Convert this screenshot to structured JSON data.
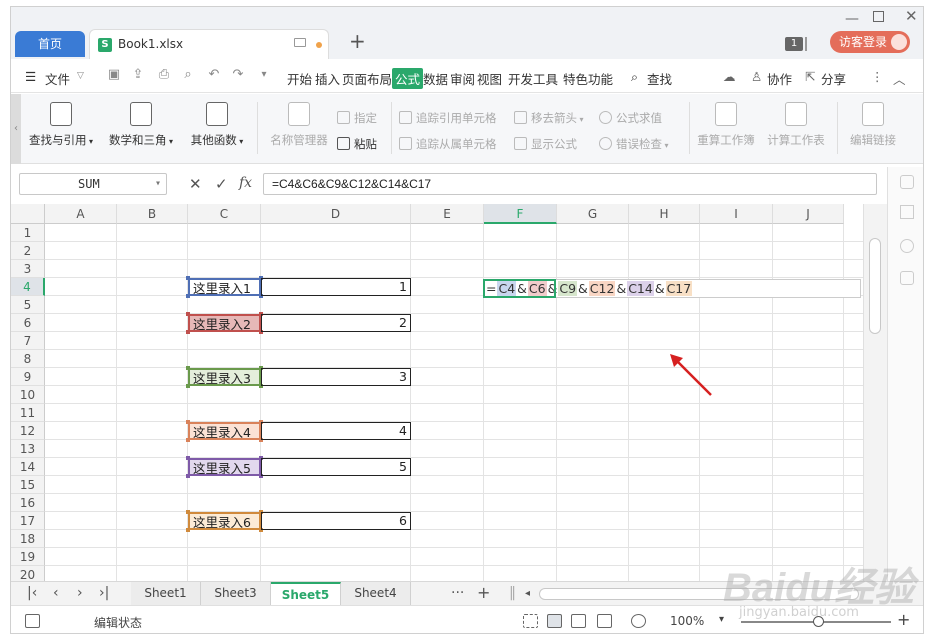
{
  "titlebar": {
    "home_tab": "首页",
    "file_tab": "Book1.xlsx",
    "badge_count": "1",
    "visitor_login": "访客登录"
  },
  "menu": {
    "file": "文件",
    "items": [
      "开始",
      "插入",
      "页面布局",
      "公式",
      "数据",
      "审阅",
      "视图",
      "开发工具",
      "特色功能"
    ],
    "active": "公式",
    "search": "查找",
    "collab": "协作",
    "share": "分享"
  },
  "ribbon": {
    "lookup": "查找与引用",
    "math": "数学和三角",
    "other_funcs": "其他函数",
    "name_manager": "名称管理器",
    "define": "指定",
    "paste": "粘贴",
    "trace_precedents": "追踪引用单元格",
    "trace_dependents": "追踪从属单元格",
    "remove_arrows": "移去箭头",
    "show_formulas": "显示公式",
    "evaluate": "公式求值",
    "error_check": "错误检查",
    "recalc_book": "重算工作簿",
    "calc_sheet": "计算工作表",
    "edit_links": "编辑链接"
  },
  "formula_bar": {
    "name_box": "SUM",
    "fx": "fx",
    "formula": "=C4&C6&C9&C12&C14&C17"
  },
  "grid": {
    "columns": [
      "A",
      "B",
      "C",
      "D",
      "E",
      "F",
      "G",
      "H",
      "I",
      "J"
    ],
    "selected_column": "F",
    "rows": [
      "1",
      "2",
      "3",
      "4",
      "5",
      "6",
      "7",
      "8",
      "9",
      "10",
      "11",
      "12",
      "13",
      "14",
      "15",
      "16",
      "17",
      "18",
      "19",
      "20"
    ],
    "selected_row": "4",
    "entries": [
      {
        "row": "4",
        "label": "这里录入1",
        "value": "1",
        "color": "#4f6fb5",
        "fill": "#ffffff"
      },
      {
        "row": "6",
        "label": "这里录入2",
        "value": "2",
        "color": "#c0504d",
        "fill": "#e6b8b7"
      },
      {
        "row": "9",
        "label": "这里录入3",
        "value": "3",
        "color": "#6a9a4c",
        "fill": "#e4eedb"
      },
      {
        "row": "12",
        "label": "这里录入4",
        "value": "4",
        "color": "#d9825a",
        "fill": "#fbe2d5"
      },
      {
        "row": "14",
        "label": "这里录入5",
        "value": "5",
        "color": "#7e5aa8",
        "fill": "#e2d8ee"
      },
      {
        "row": "17",
        "label": "这里录入6",
        "value": "6",
        "color": "#d08a3c",
        "fill": "#fcebd6"
      }
    ],
    "edit_tokens": [
      {
        "text": "=",
        "bg": ""
      },
      {
        "text": "C4",
        "bg": "#c9d6ee"
      },
      {
        "text": "&",
        "bg": ""
      },
      {
        "text": "C6",
        "bg": "#f1cccb"
      },
      {
        "text": "&",
        "bg": ""
      },
      {
        "text": "C9",
        "bg": "#d6e6cc"
      },
      {
        "text": "&",
        "bg": ""
      },
      {
        "text": "C12",
        "bg": "#f9d6c4"
      },
      {
        "text": "&",
        "bg": ""
      },
      {
        "text": "C14",
        "bg": "#dcd1ea"
      },
      {
        "text": "&",
        "bg": ""
      },
      {
        "text": "C17",
        "bg": "#f8e0c6"
      }
    ]
  },
  "sheets": {
    "tabs": [
      "Sheet1",
      "Sheet3",
      "Sheet5",
      "Sheet4"
    ],
    "active": "Sheet5",
    "more": "···",
    "add": "+"
  },
  "status": {
    "mode": "编辑状态",
    "zoom": "100%"
  },
  "watermark": {
    "brand": "Baidu经验",
    "url": "jingyan.baidu.com"
  },
  "colors": {
    "accent": "#2aa86b",
    "home_tab": "#3a7bd5",
    "visitor": "#e46d5a",
    "arrow": "#d62020"
  }
}
